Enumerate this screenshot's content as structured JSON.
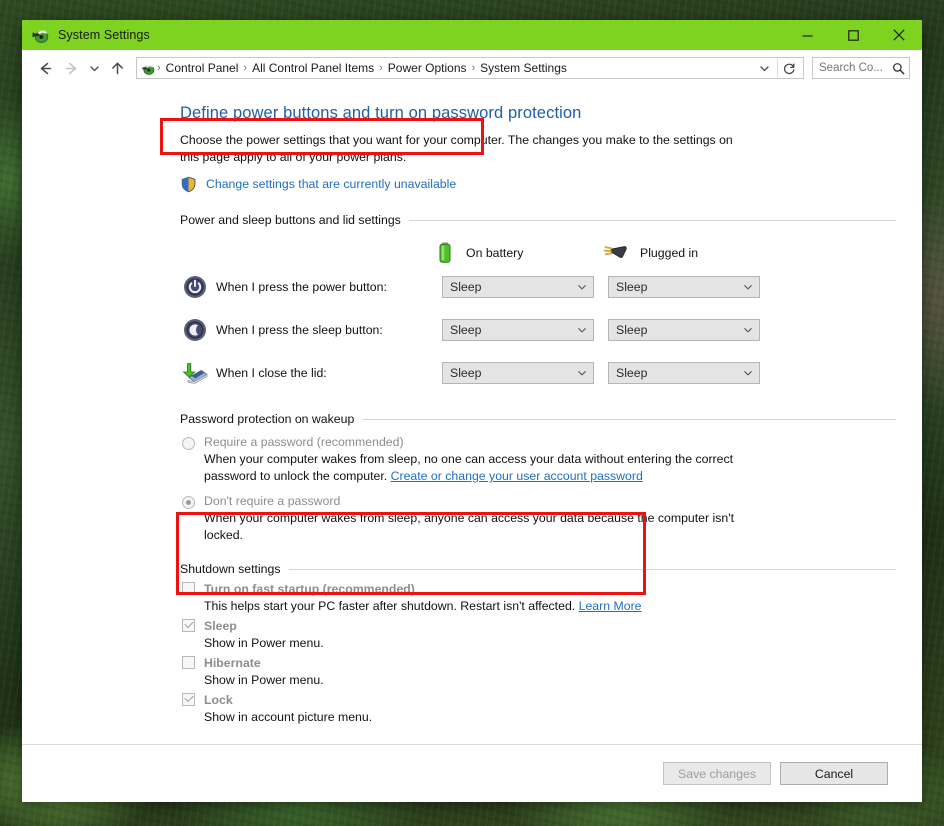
{
  "window": {
    "title": "System Settings",
    "title_icon": "system-settings-icon",
    "controls": {
      "minimize": "Minimize",
      "maximize": "Maximize",
      "close": "Close"
    },
    "accent_color": "#7ed321"
  },
  "nav": {
    "back": "Back",
    "forward": "Forward",
    "recent": "Recent locations",
    "up": "Up",
    "refresh": "Refresh",
    "separator": "›",
    "breadcrumbs": [
      {
        "label": "Control Panel"
      },
      {
        "label": "All Control Panel Items"
      },
      {
        "label": "Power Options"
      },
      {
        "label": "System Settings"
      }
    ],
    "dropdown_icon": "chevron-down-icon"
  },
  "search": {
    "value": "Search Co...",
    "placeholder": "Search Control Panel",
    "icon": "search-icon"
  },
  "page": {
    "title": "Define power buttons and turn on password protection",
    "description": "Choose the power settings that you want for your computer. The changes you make to the settings on this page apply to all of your power plans.",
    "admin_link": "Change settings that are currently unavailable",
    "admin_link_icon": "shield-icon"
  },
  "power_section": {
    "group_label": "Power and sleep buttons and lid settings",
    "columns": [
      {
        "label": "On battery",
        "icon": "battery-icon"
      },
      {
        "label": "Plugged in",
        "icon": "power-plug-icon"
      }
    ],
    "rows": [
      {
        "icon": "power-button-icon",
        "label": "When I press the power button:",
        "battery": "Sleep",
        "plugged": "Sleep"
      },
      {
        "icon": "sleep-moon-icon",
        "label": "When I press the sleep button:",
        "battery": "Sleep",
        "plugged": "Sleep"
      },
      {
        "icon": "laptop-lid-icon",
        "label": "When I close the lid:",
        "battery": "Sleep",
        "plugged": "Sleep"
      }
    ]
  },
  "password_section": {
    "group_label": "Password protection on wakeup",
    "options": [
      {
        "title": "Require a password (recommended)",
        "selected": false,
        "body_before": "When your computer wakes from sleep, no one can access your data without entering the correct password to unlock the computer. ",
        "link": "Create or change your user account password",
        "body_after": ""
      },
      {
        "title": "Don't require a password",
        "selected": true,
        "body_before": "When your computer wakes from sleep, anyone can access your data because the computer isn't locked.",
        "link": "",
        "body_after": ""
      }
    ]
  },
  "shutdown_section": {
    "group_label": "Shutdown settings",
    "items": [
      {
        "title": "Turn on fast startup (recommended)",
        "checked": false,
        "desc_before": "This helps start your PC faster after shutdown. Restart isn't affected. ",
        "link": "Learn More"
      },
      {
        "title": "Sleep",
        "checked": true,
        "desc_before": "Show in Power menu.",
        "link": ""
      },
      {
        "title": "Hibernate",
        "checked": false,
        "desc_before": "Show in Power menu.",
        "link": ""
      },
      {
        "title": "Lock",
        "checked": true,
        "desc_before": "Show in account picture menu.",
        "link": ""
      }
    ]
  },
  "footer": {
    "save_label": "Save changes",
    "save_disabled": true,
    "cancel_label": "Cancel"
  },
  "annotations": {
    "highlight_color": "#ee1111",
    "boxes": [
      {
        "name": "admin-link-highlight"
      },
      {
        "name": "fast-startup-highlight"
      }
    ]
  }
}
